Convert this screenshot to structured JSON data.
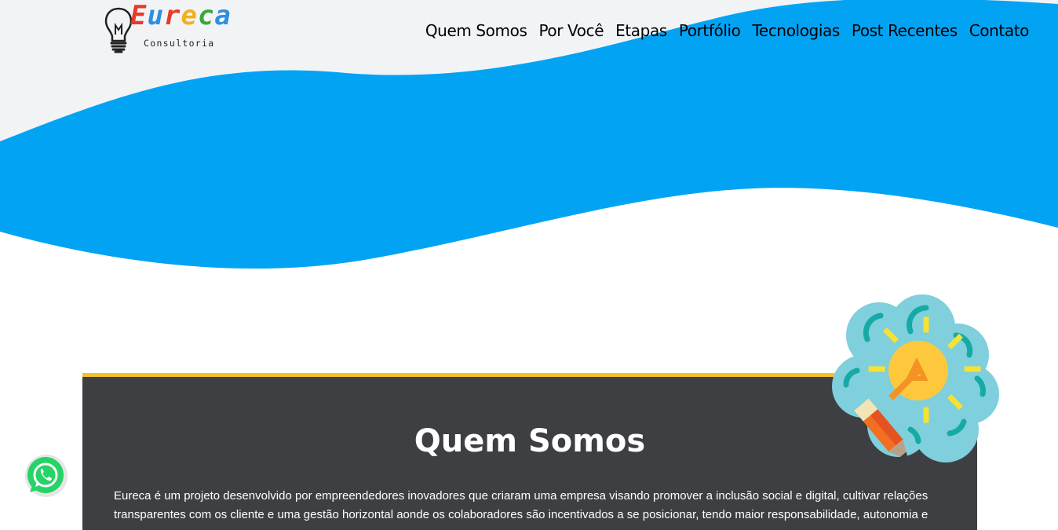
{
  "header": {
    "logo": {
      "word_letters": [
        "E",
        "u",
        "r",
        "e",
        "c",
        "a"
      ],
      "word_colors": [
        "#e8392a",
        "#2e8ee0",
        "#e8392a",
        "#f2b01e",
        "#39a83b",
        "#2e8ee0"
      ],
      "tagline": "Consultoria",
      "icon": "lightbulb-icon"
    },
    "nav": [
      "Quem Somos",
      "Por Você",
      "Etapas",
      "Portfólio",
      "Tecnologias",
      "Post Recentes",
      "Contato"
    ]
  },
  "hero": {
    "wave_color": "#03a3f4",
    "band_color": "#f2f3f5"
  },
  "about": {
    "title": "Quem Somos",
    "text": "Eureca é um projeto desenvolvido por empreendedores inovadores que criaram uma empresa visando promover a inclusão social e digital, cultivar relações transparentes com os cliente e uma gestão horizontal aonde os colaboradores são incentivados a se posicionar, tendo maior responsabilidade, autonomia e",
    "accent_color": "#f4c22b",
    "card_color": "#3d3f42",
    "illustration": "idea-pencil-icon"
  },
  "floating": {
    "whatsapp_icon": "whatsapp-icon",
    "whatsapp_color": "#25d366"
  }
}
